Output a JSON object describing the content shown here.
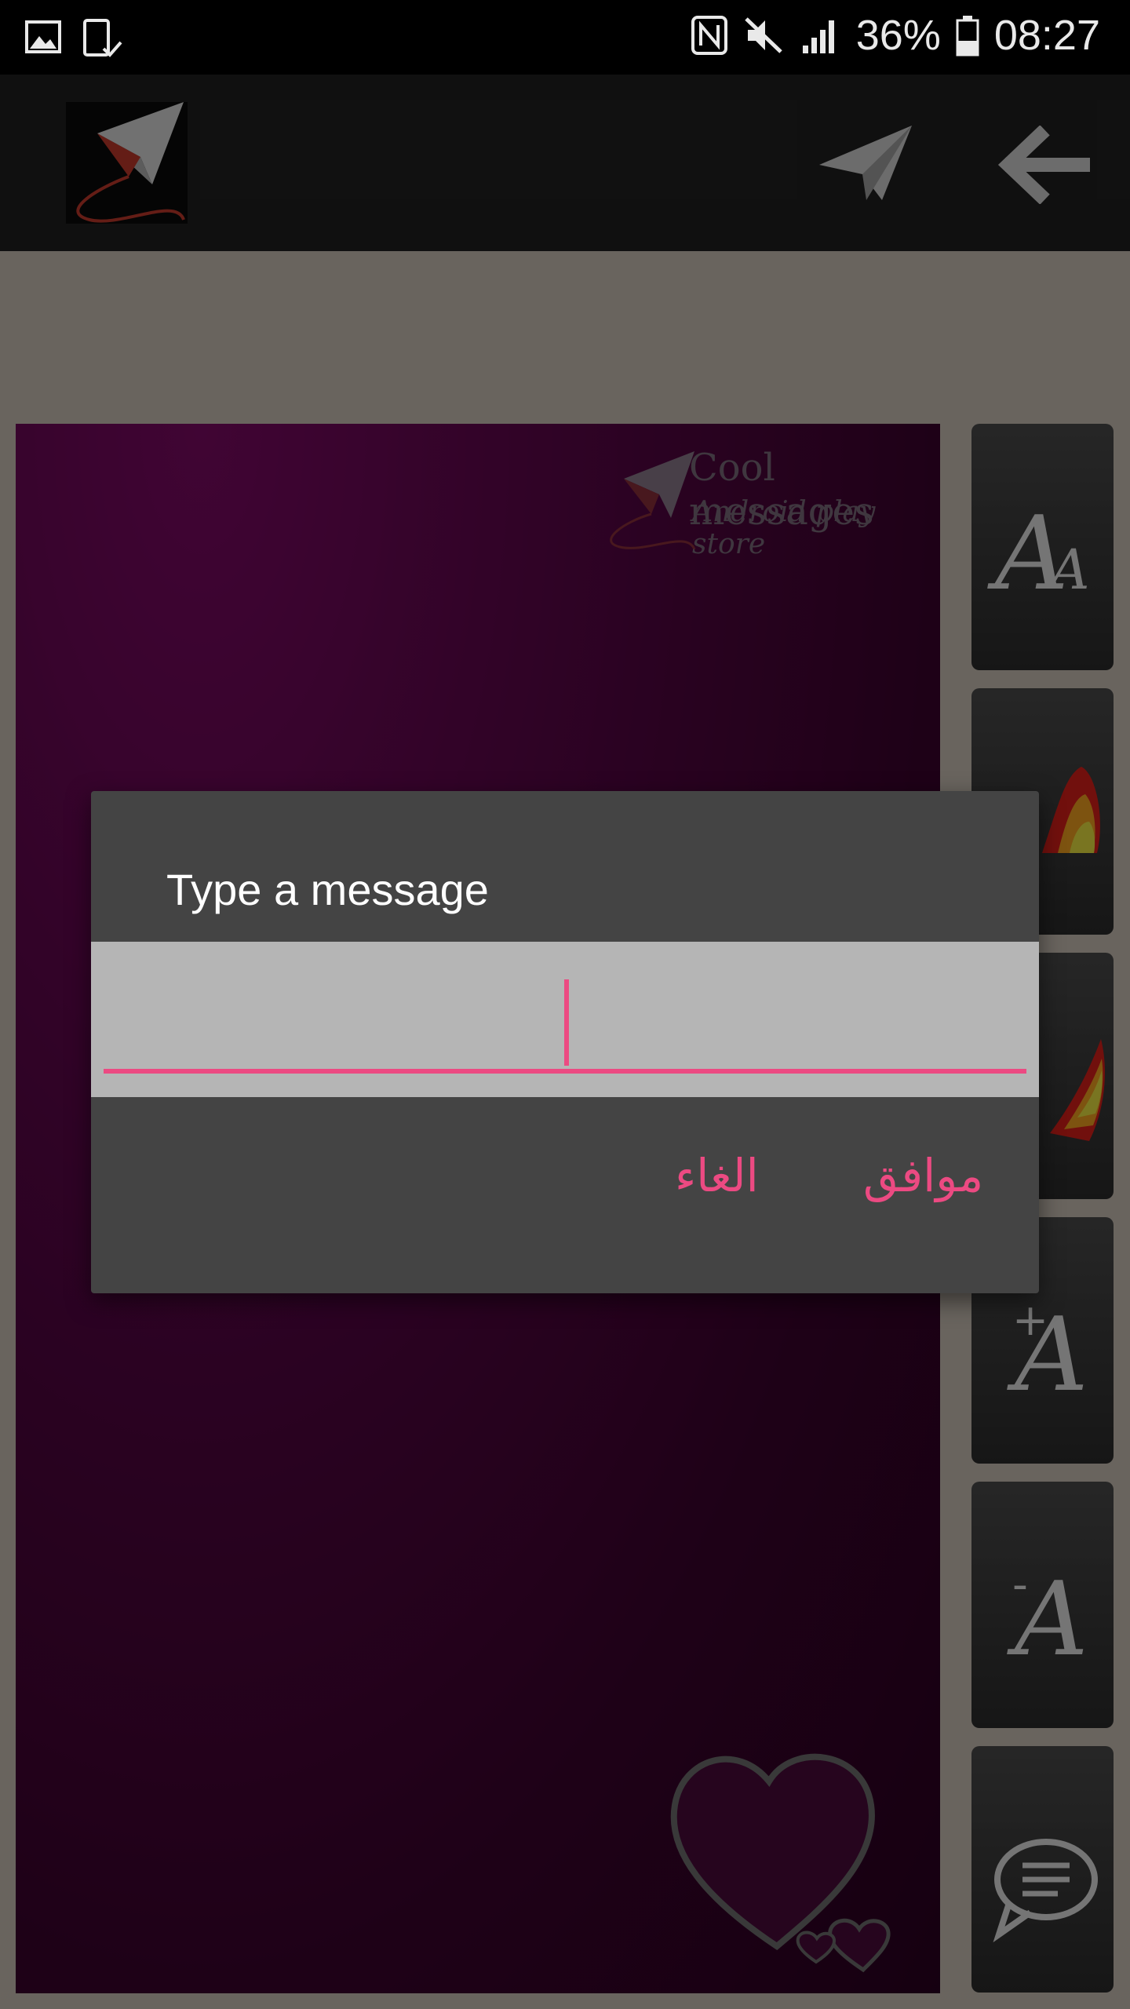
{
  "status_bar": {
    "battery": "36%",
    "time": "08:27",
    "left_icons": [
      "gallery-icon",
      "phone-check-icon"
    ],
    "right_icons": [
      "nfc-icon",
      "mute-icon",
      "signal-icon",
      "battery-icon"
    ]
  },
  "app_bar": {
    "icons": [
      "app-logo-icon",
      "send-icon",
      "back-arrow-icon"
    ]
  },
  "canvas": {
    "watermark_line1": "Cool messages",
    "watermark_line2": "Android play store",
    "background_color": "#5a0648"
  },
  "side_toolbar": {
    "buttons": [
      "font-style-icon",
      "color-palette-icon",
      "color-palette-icon",
      "increase-font-icon",
      "decrease-font-icon",
      "message-bubble-icon"
    ]
  },
  "dialog": {
    "title": "Type a message",
    "input_value": "",
    "cancel_label": "الغاء",
    "ok_label": "موافق",
    "accent_color": "#ec4a82"
  }
}
